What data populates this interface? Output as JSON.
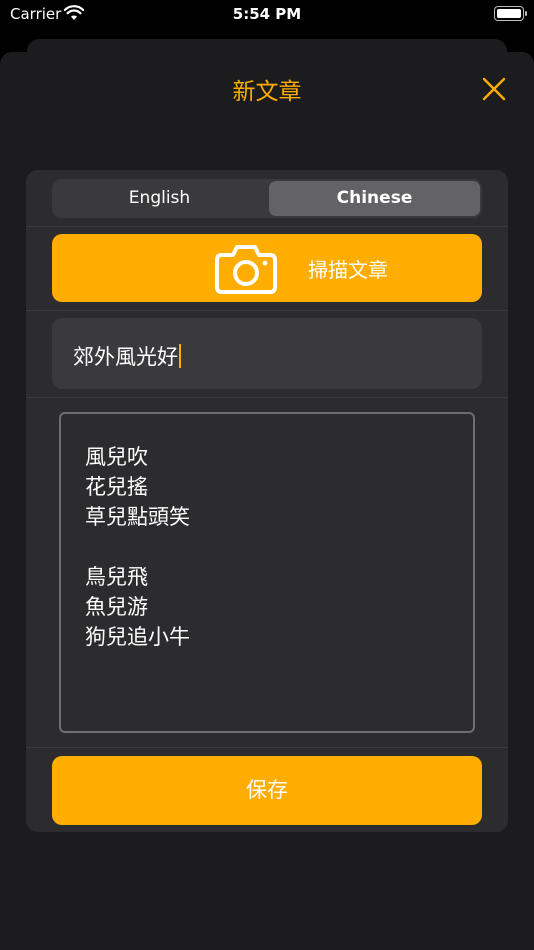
{
  "status_bar": {
    "carrier": "Carrier",
    "time": "5:54 PM"
  },
  "header": {
    "title": "新文章",
    "close_icon": "close-icon"
  },
  "language_selector": {
    "options": [
      "English",
      "Chinese"
    ],
    "selected": "Chinese"
  },
  "scan_button": {
    "label": "掃描文章",
    "icon": "camera-icon"
  },
  "title_field": {
    "value": "郊外風光好"
  },
  "content_field": {
    "value": "風兒吹\n花兒搖\n草兒點頭笑\n\n鳥兒飛\n魚兒游\n狗兒追小牛"
  },
  "save_button": {
    "label": "保存"
  },
  "colors": {
    "accent": "#ffad00",
    "background": "#000000",
    "sheet": "#1c1c1e",
    "card": "#2c2c2e",
    "field": "#3a3a3c",
    "selected_segment": "#636366"
  }
}
